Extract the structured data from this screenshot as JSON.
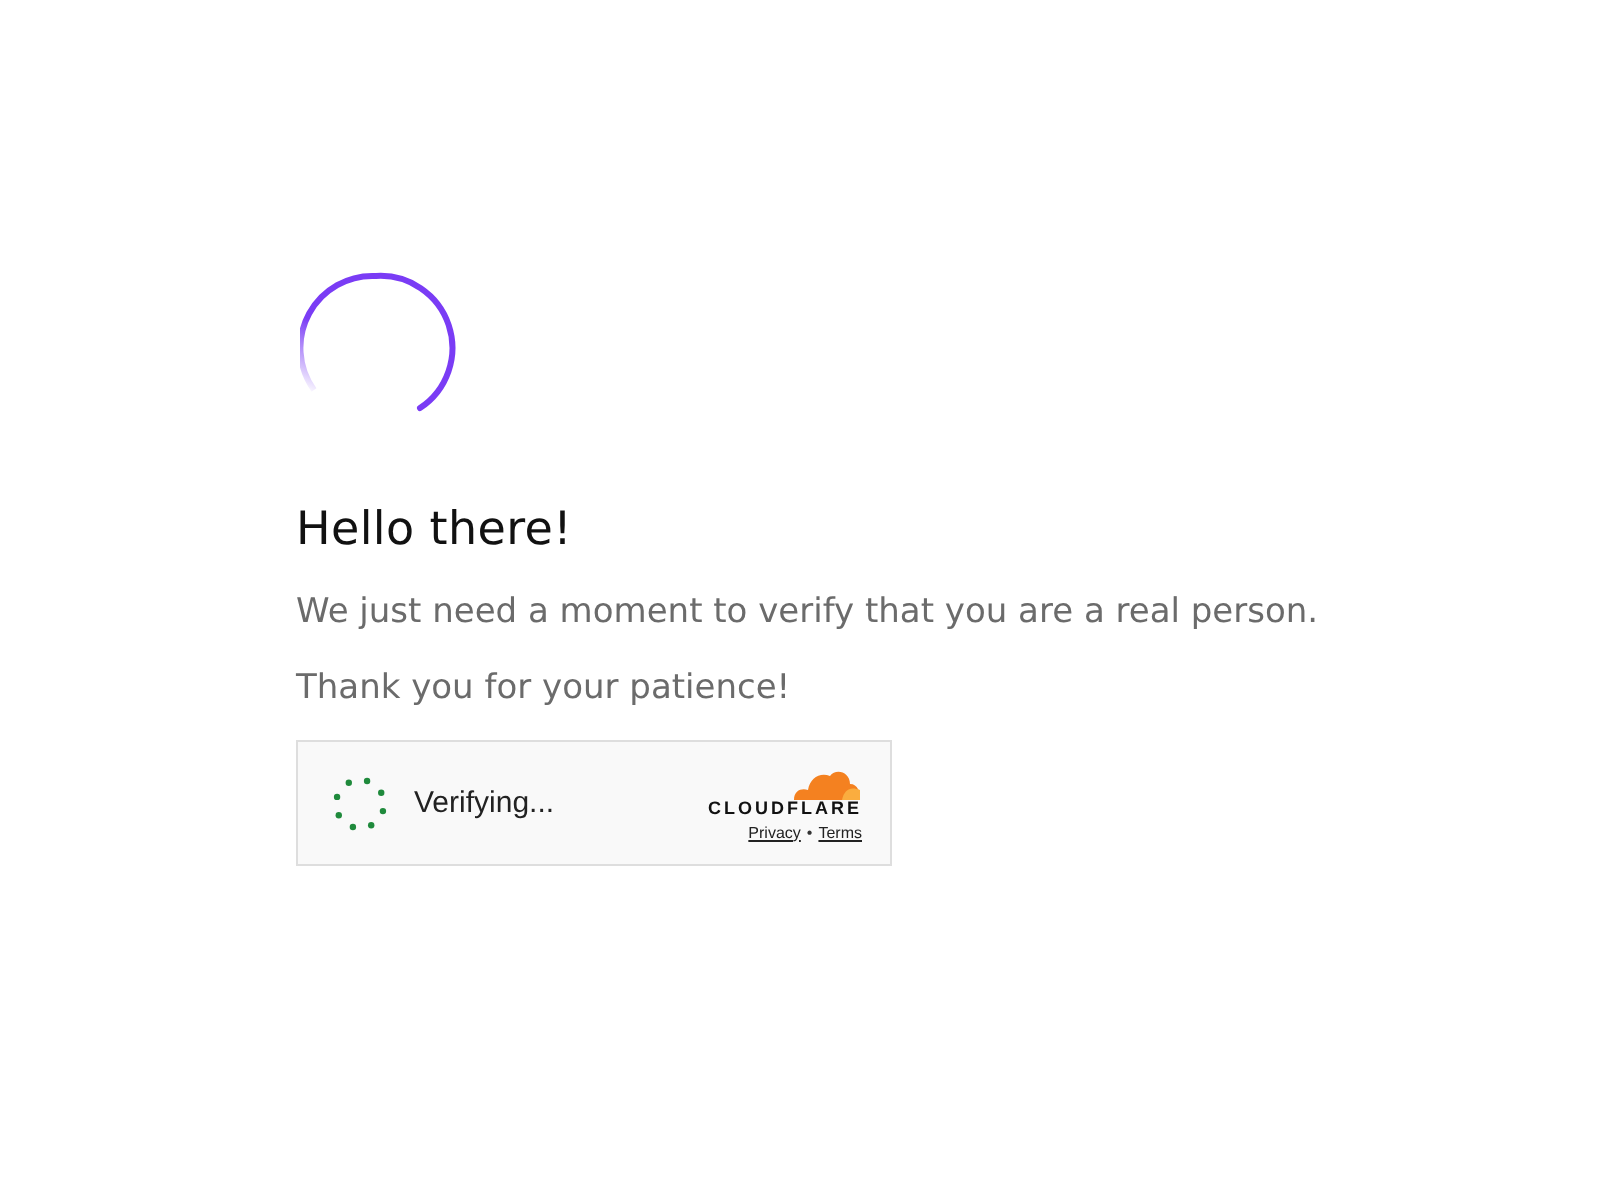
{
  "heading": "Hello there!",
  "paragraphs": [
    "We just need a moment to verify that you are a real person.",
    "Thank you for your patience!"
  ],
  "widget": {
    "status": "Verifying...",
    "brand": "CLOUDFLARE",
    "links": [
      "Privacy",
      "Terms"
    ],
    "separator": "•"
  }
}
